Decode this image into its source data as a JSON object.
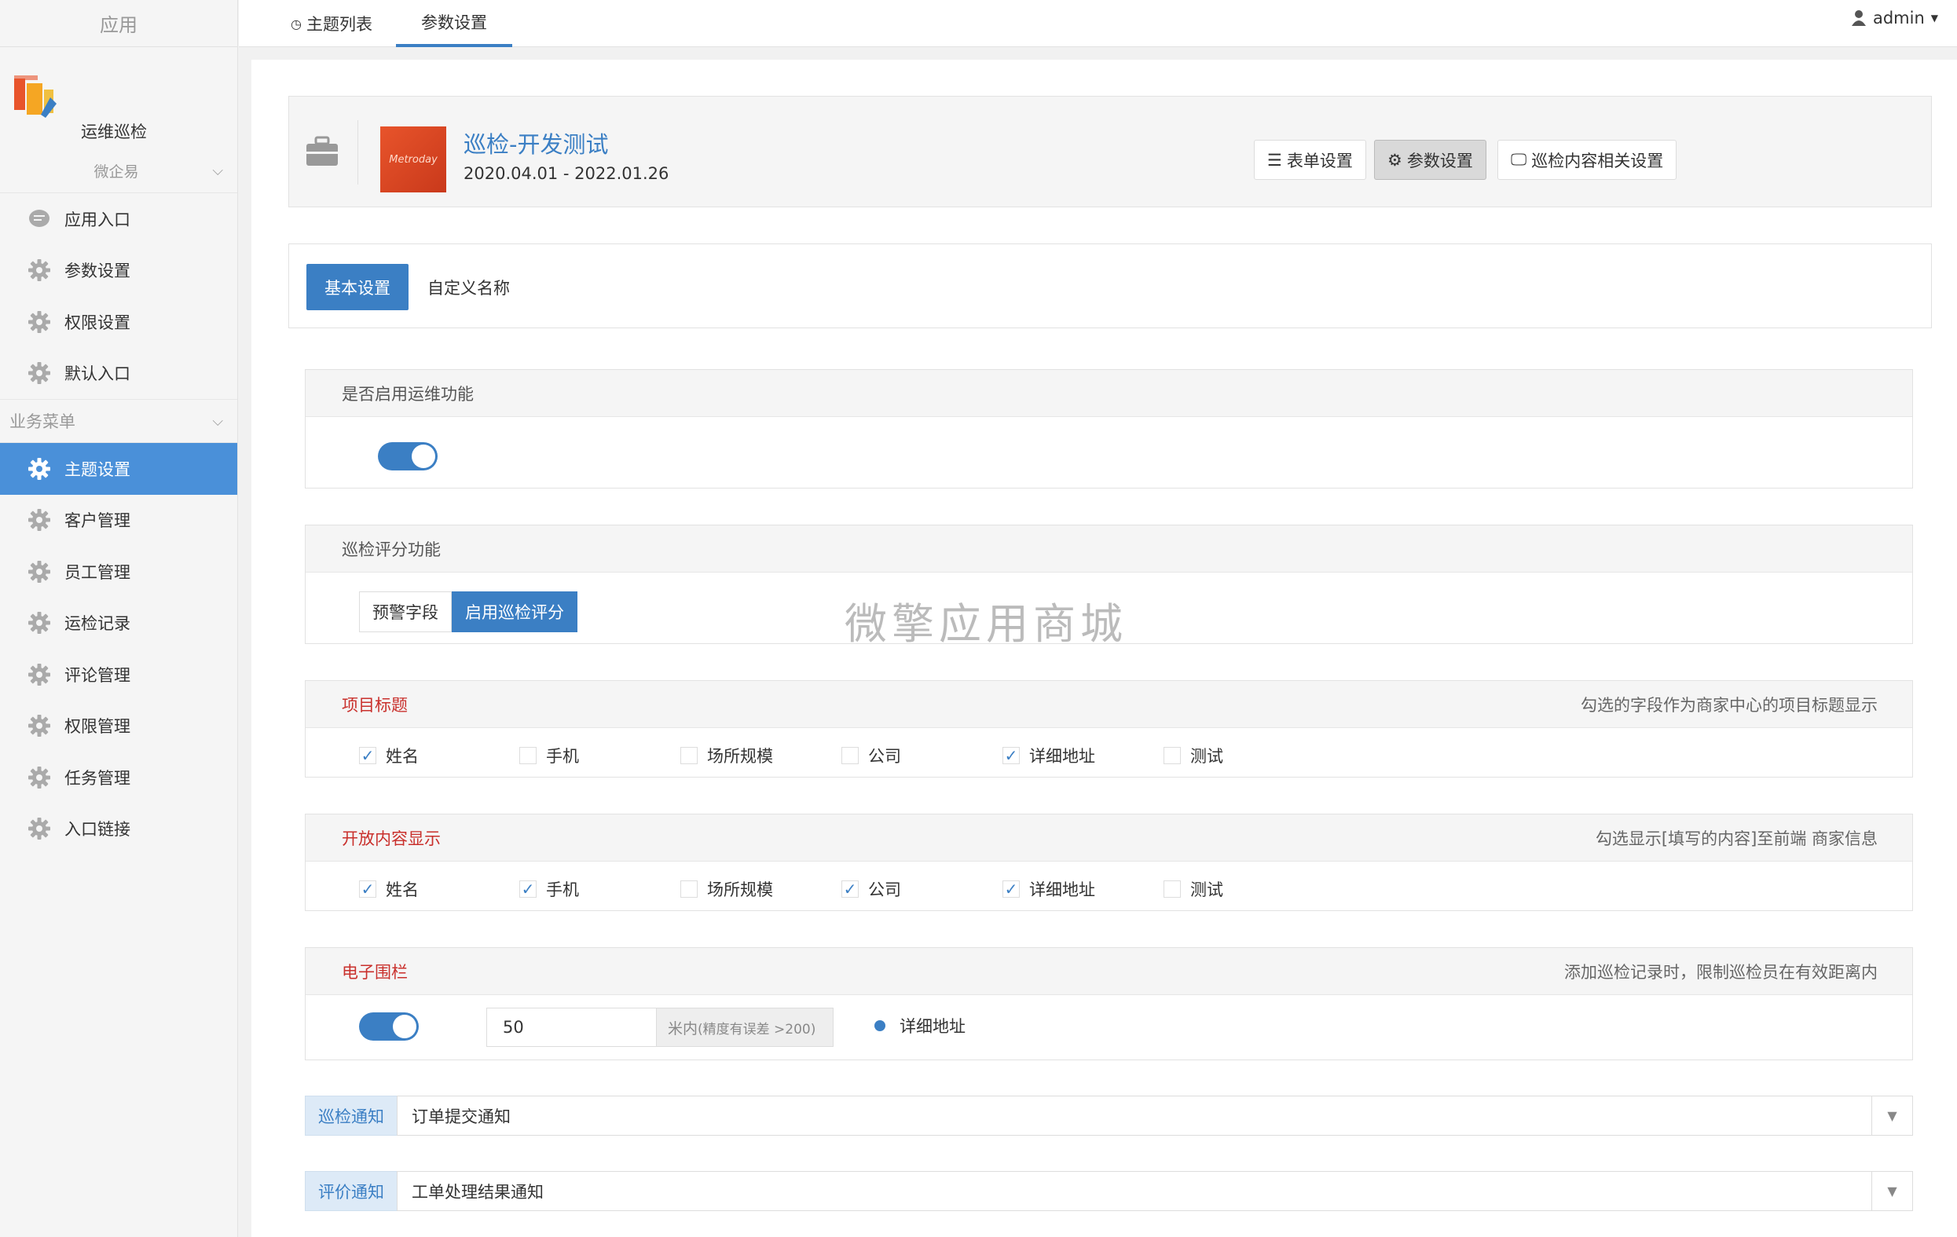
{
  "sidebar": {
    "top_label": "应用",
    "app_name": "运维巡检",
    "group1": {
      "label": "微企易"
    },
    "items1": [
      {
        "label": "应用入口",
        "icon": "chat-icon"
      },
      {
        "label": "参数设置",
        "icon": "gear-icon"
      },
      {
        "label": "权限设置",
        "icon": "gear-icon"
      },
      {
        "label": "默认入口",
        "icon": "gear-icon"
      }
    ],
    "group2": {
      "label": "业务菜单"
    },
    "items2": [
      {
        "label": "主题设置",
        "active": true
      },
      {
        "label": "客户管理"
      },
      {
        "label": "员工管理"
      },
      {
        "label": "运检记录"
      },
      {
        "label": "评论管理"
      },
      {
        "label": "权限管理"
      },
      {
        "label": "任务管理"
      },
      {
        "label": "入口链接"
      }
    ]
  },
  "topbar": {
    "tab1": "主题列表",
    "tab2": "参数设置",
    "user": "admin"
  },
  "theme": {
    "title": "巡检-开发测试",
    "dates": "2020.04.01 - 2022.01.26",
    "thumb_text": "Metroday",
    "btn_form": "表单设置",
    "btn_params": "参数设置",
    "btn_content": "巡检内容相关设置"
  },
  "subtabs": {
    "basic": "基本设置",
    "custom": "自定义名称"
  },
  "ops": {
    "label": "是否启用运维功能",
    "enabled": true
  },
  "score": {
    "label": "巡检评分功能",
    "opt1": "预警字段",
    "opt2": "启用巡检评分"
  },
  "watermark": "微擎应用商城",
  "project_title": {
    "label": "项目标题",
    "hint": "勾选的字段作为商家中心的项目标题显示",
    "fields": [
      {
        "label": "姓名",
        "checked": true
      },
      {
        "label": "手机",
        "checked": false
      },
      {
        "label": "场所规模",
        "checked": false
      },
      {
        "label": "公司",
        "checked": false
      },
      {
        "label": "详细地址",
        "checked": true
      },
      {
        "label": "测试",
        "checked": false
      }
    ]
  },
  "open_content": {
    "label": "开放内容显示",
    "hint": "勾选显示[填写的内容]至前端 商家信息",
    "fields": [
      {
        "label": "姓名",
        "checked": true
      },
      {
        "label": "手机",
        "checked": true
      },
      {
        "label": "场所规模",
        "checked": false
      },
      {
        "label": "公司",
        "checked": true
      },
      {
        "label": "详细地址",
        "checked": true
      },
      {
        "label": "测试",
        "checked": false
      }
    ]
  },
  "fence": {
    "label": "电子围栏",
    "hint": "添加巡检记录时，限制巡检员在有效距离内",
    "enabled": true,
    "distance": "50",
    "unit": "米内",
    "unit_note": "(精度有误差 >200)",
    "radio_label": "详细地址"
  },
  "notify_check": {
    "label": "巡检通知",
    "value": "订单提交通知"
  },
  "notify_review": {
    "label": "评价通知",
    "value": "工单处理结果通知"
  },
  "colors": {
    "accent": "#3b7fc4",
    "active_menu": "#4a90d9",
    "danger": "#c9302c"
  }
}
